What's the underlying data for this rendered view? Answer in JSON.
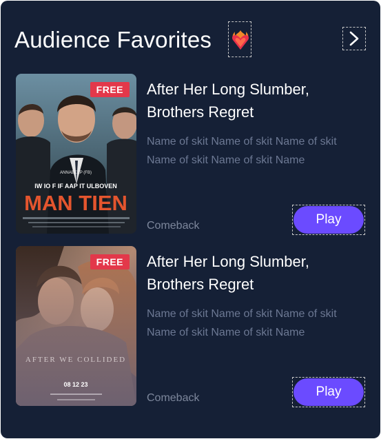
{
  "section": {
    "title": "Audience Favorites",
    "title_icon": "heart-on-fire-icon",
    "next_icon": "chevron-right-icon"
  },
  "colors": {
    "background": "#152036",
    "accent": "#6b4bff",
    "badge": "#e3384a",
    "muted_text": "#6c7893"
  },
  "items": [
    {
      "badge": "FREE",
      "title": "After Her Long Slumber, Brothers Regret",
      "description": "Name of skit Name of skit Name of skit Name of skit Name of skit Name",
      "tag": "Comeback",
      "play_label": "Play",
      "poster_text": {
        "top_small": "ANNABEEP (FB)",
        "subtitle": "IW IO F IF AAP IT ULBOVEN",
        "main": "MAN TIEN"
      }
    },
    {
      "badge": "FREE",
      "title": "After Her Long Slumber, Brothers Regret",
      "description": "Name of skit Name of skit Name of skit Name of skit Name of skit Name",
      "tag": "Comeback",
      "play_label": "Play",
      "poster_text": {
        "main": "AFTER WE COLLIDED",
        "date": "08 12 23"
      }
    }
  ]
}
